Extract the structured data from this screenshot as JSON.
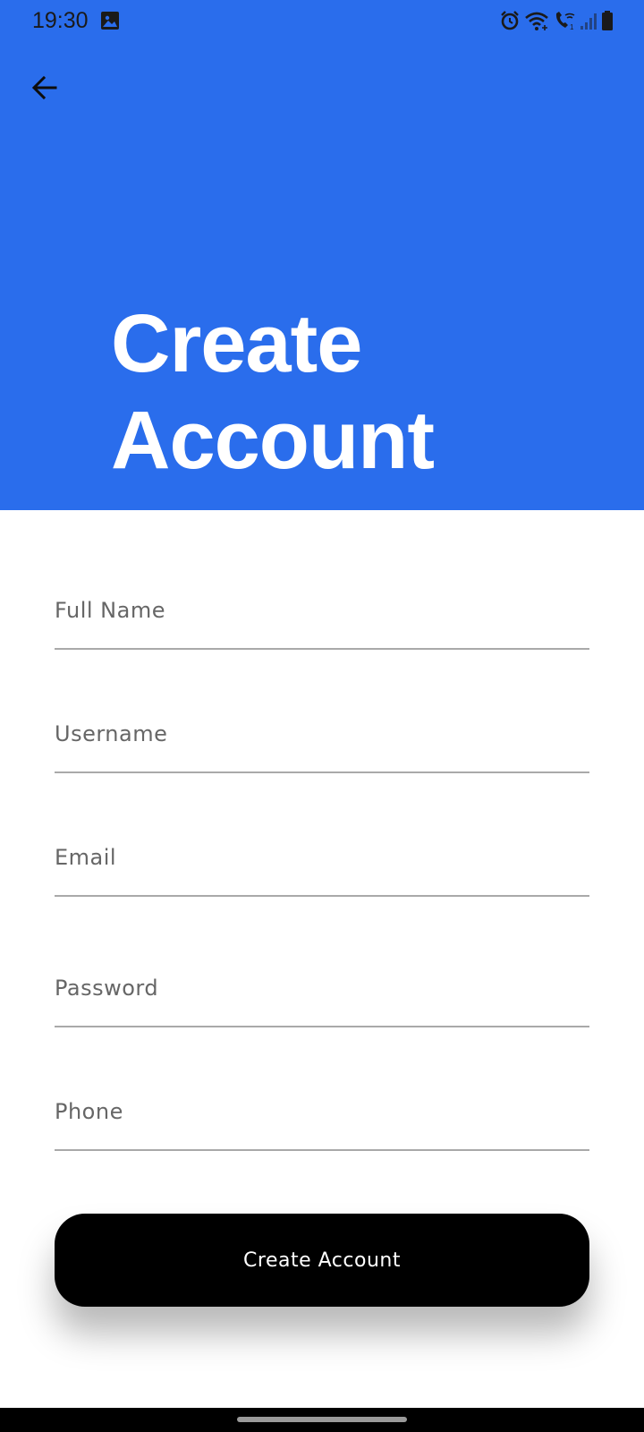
{
  "status_bar": {
    "time": "19:30",
    "icons": [
      "gallery-icon",
      "alarm-icon",
      "wifi-icon",
      "wifi-calling-icon",
      "signal-icon",
      "battery-icon"
    ]
  },
  "header": {
    "background_color": "#2A6DEC",
    "back_icon": "arrow-left-icon",
    "title_line1": "Create",
    "title_line2": "Account"
  },
  "form": {
    "full_name": {
      "placeholder": "Full Name",
      "value": ""
    },
    "username": {
      "placeholder": "Username",
      "value": ""
    },
    "email": {
      "placeholder": "Email",
      "value": ""
    },
    "password": {
      "placeholder": "Password",
      "value": ""
    },
    "phone": {
      "placeholder": "Phone",
      "value": ""
    },
    "submit_label": "Create Account"
  }
}
